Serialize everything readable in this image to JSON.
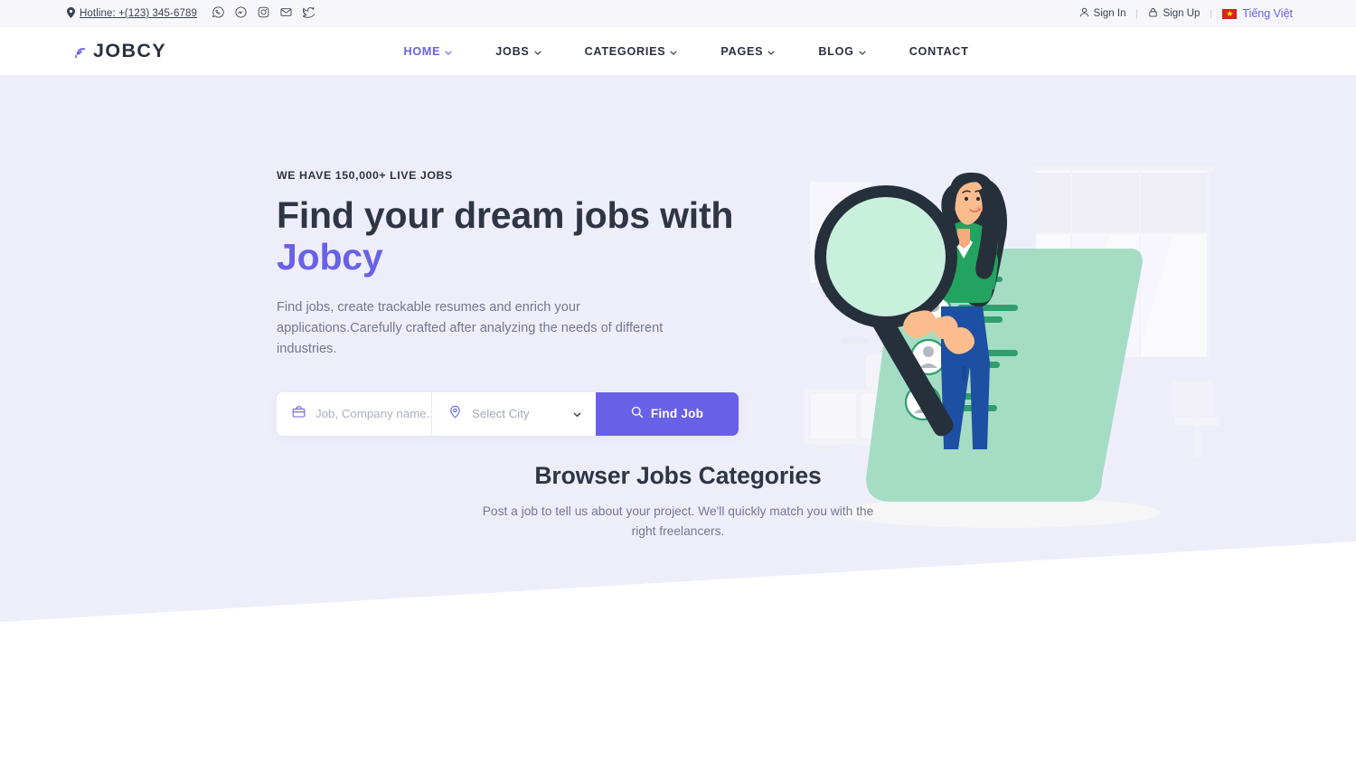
{
  "theme": {
    "accent": "#6861e8",
    "hero_bg": "#eeeefb",
    "topbar_bg": "#f6f6fb",
    "heading": "#2f3543",
    "muted": "#74788c",
    "illustration_mint": "#a5ddc4",
    "illustration_green": "#1f9d55",
    "illustration_denim": "#1d4fa3",
    "illustration_dark": "#25303b"
  },
  "topbar": {
    "hotline_label": "Hotline: +(123) 345-6789",
    "location_icon": "location-pin-icon",
    "socials": [
      {
        "name": "whatsapp-icon",
        "label": "WhatsApp"
      },
      {
        "name": "messenger-icon",
        "label": "Messenger"
      },
      {
        "name": "instagram-icon",
        "label": "Instagram"
      },
      {
        "name": "mail-icon",
        "label": "Email"
      },
      {
        "name": "twitter-icon",
        "label": "Twitter"
      }
    ],
    "sign_in": "Sign In",
    "sign_in_icon": "user-icon",
    "sign_up": "Sign Up",
    "sign_up_icon": "lock-icon",
    "language": "Tiếng Việt",
    "language_flag": "vietnam-flag-icon",
    "language_color": "#6861e8"
  },
  "header": {
    "brand_name": "JOBCY",
    "brand_icon": "spiral-logo-icon",
    "nav": [
      {
        "label": "HOME",
        "active": true,
        "has_dropdown": true
      },
      {
        "label": "JOBS",
        "active": false,
        "has_dropdown": true
      },
      {
        "label": "CATEGORIES",
        "active": false,
        "has_dropdown": true
      },
      {
        "label": "PAGES",
        "active": false,
        "has_dropdown": true
      },
      {
        "label": "BLOG",
        "active": false,
        "has_dropdown": true
      },
      {
        "label": "CONTACT",
        "active": false,
        "has_dropdown": false
      }
    ]
  },
  "hero": {
    "eyebrow": "WE HAVE 150,000+ LIVE JOBS",
    "title_line1": "Find your dream jobs with",
    "title_accent": "Jobcy",
    "subtitle": "Find jobs, create trackable resumes and enrich your applications.Carefully crafted after analyzing the needs of different industries.",
    "search": {
      "keyword_placeholder": "Job, Company name...",
      "keyword_value": "",
      "keyword_icon": "briefcase-icon",
      "city_selected": "Select City",
      "city_icon": "map-pin-icon",
      "city_caret_icon": "chevron-down-icon",
      "submit_label": "Find Job",
      "submit_icon": "search-icon"
    },
    "illustration_name": "woman-with-magnifier-and-resume-illustration"
  },
  "categories_section": {
    "title": "Browser Jobs Categories",
    "subtitle": "Post a job to tell us about your project. We'll quickly match you with the right freelancers."
  }
}
